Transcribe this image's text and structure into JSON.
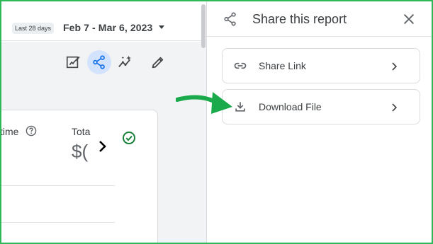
{
  "report": {
    "date_range_badge": "Last 28 days",
    "date_range": "Feb 7 - Mar 6, 2023",
    "toolbar": [
      {
        "name": "edit-report-icon"
      },
      {
        "name": "share-icon",
        "active": true
      },
      {
        "name": "insights-icon"
      },
      {
        "name": "pencil-icon"
      }
    ],
    "card": {
      "metric1_label": "time",
      "metric2_label": "Tota",
      "metric2_value": "$(",
      "icons": [
        "help-icon",
        "chevron-right-icon",
        "check-circle-icon"
      ]
    }
  },
  "share_panel": {
    "title": "Share this report",
    "options": [
      {
        "label": "Share Link",
        "icon": "link-icon"
      },
      {
        "label": "Download File",
        "icon": "download-icon"
      }
    ]
  },
  "colors": {
    "frame": "#2fb85a",
    "arrow": "#1aaa4b",
    "active_icon_bg": "#d3e3fd",
    "active_icon": "#1a73e8",
    "check": "#188038"
  }
}
